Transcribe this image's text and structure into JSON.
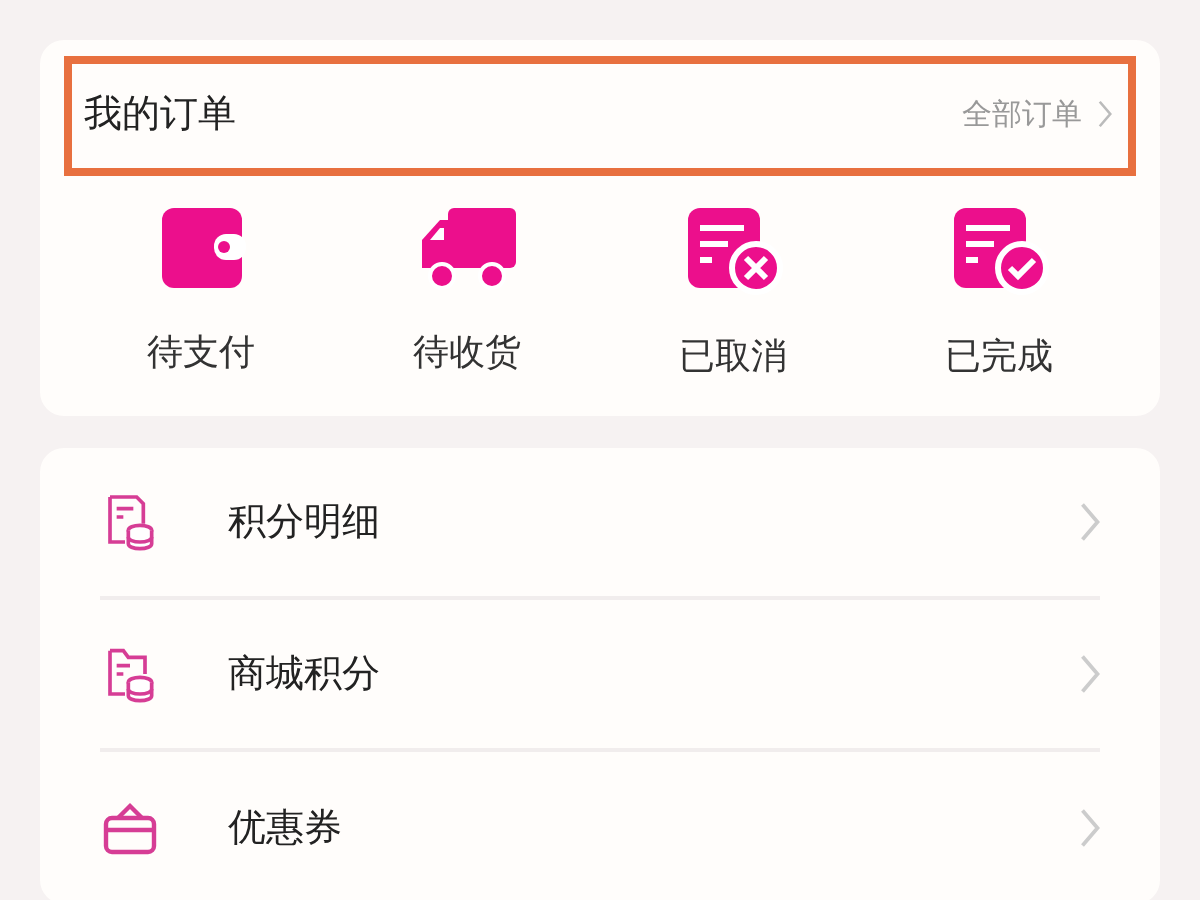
{
  "orders": {
    "title": "我的订单",
    "all_link": "全部订单",
    "highlighted": true,
    "statuses": [
      {
        "kind": "wallet",
        "label": "待支付"
      },
      {
        "kind": "truck",
        "label": "待收货"
      },
      {
        "kind": "cancelled",
        "label": "已取消"
      },
      {
        "kind": "completed",
        "label": "已完成"
      }
    ]
  },
  "menu": [
    {
      "kind": "points",
      "label": "积分明细"
    },
    {
      "kind": "mall",
      "label": "商城积分"
    },
    {
      "kind": "coupon",
      "label": "优惠券"
    }
  ]
}
